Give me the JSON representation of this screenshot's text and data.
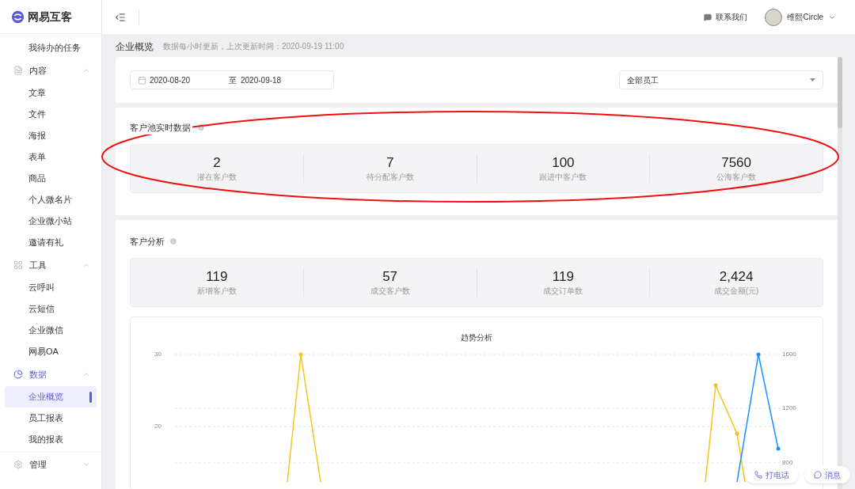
{
  "brand": {
    "name": "网易互客"
  },
  "header": {
    "contact": "联系我们",
    "user": "维熙Circle"
  },
  "sidebar": {
    "items": [
      {
        "kind": "item",
        "label": "我待办的任务",
        "selected": false
      },
      {
        "kind": "group",
        "label": "内容",
        "expanded": true,
        "selected": false,
        "children": [
          {
            "label": "文章",
            "selected": false
          },
          {
            "label": "文件",
            "selected": false
          },
          {
            "label": "海报",
            "selected": false
          },
          {
            "label": "表单",
            "selected": false
          },
          {
            "label": "商品",
            "selected": false
          },
          {
            "label": "个人微名片",
            "selected": false
          },
          {
            "label": "企业微小站",
            "selected": false
          },
          {
            "label": "邀请有礼",
            "selected": false
          }
        ]
      },
      {
        "kind": "group",
        "label": "工具",
        "expanded": true,
        "selected": false,
        "children": [
          {
            "label": "云呼叫",
            "selected": false
          },
          {
            "label": "云短信",
            "selected": false
          },
          {
            "label": "企业微信",
            "selected": false
          },
          {
            "label": "网易OA",
            "selected": false
          }
        ]
      },
      {
        "kind": "group",
        "label": "数据",
        "expanded": true,
        "selected": true,
        "children": [
          {
            "label": "企业概览",
            "selected": true
          },
          {
            "label": "员工报表",
            "selected": false
          },
          {
            "label": "我的报表",
            "selected": false
          }
        ]
      },
      {
        "kind": "group",
        "label": "管理",
        "expanded": false,
        "selected": false
      }
    ]
  },
  "page": {
    "title": "企业概览",
    "note": "数据每小时更新，上次更新时间：2020-09-19 11:00"
  },
  "filters": {
    "start_date": "2020-08-20",
    "separator": "至",
    "end_date": "2020-09-18",
    "staff": "全部员工"
  },
  "pool": {
    "title": "客户池实时数据",
    "stats": [
      {
        "value": "2",
        "label": "潜在客户数"
      },
      {
        "value": "7",
        "label": "待分配客户数"
      },
      {
        "value": "100",
        "label": "跟进中客户数"
      },
      {
        "value": "7560",
        "label": "公海客户数"
      }
    ]
  },
  "analysis": {
    "title": "客户分析",
    "stats": [
      {
        "value": "119",
        "label": "新增客户数"
      },
      {
        "value": "57",
        "label": "成交客户数"
      },
      {
        "value": "119",
        "label": "成交订单数"
      },
      {
        "value": "2,424",
        "label": "成交金额(元)"
      }
    ],
    "trend": {
      "title": "趋势分析",
      "left_ticks": [
        "30",
        "20"
      ],
      "right_ticks": [
        "1600",
        "1200",
        "800"
      ]
    }
  },
  "float_buttons": [
    "打电话",
    "消息"
  ]
}
